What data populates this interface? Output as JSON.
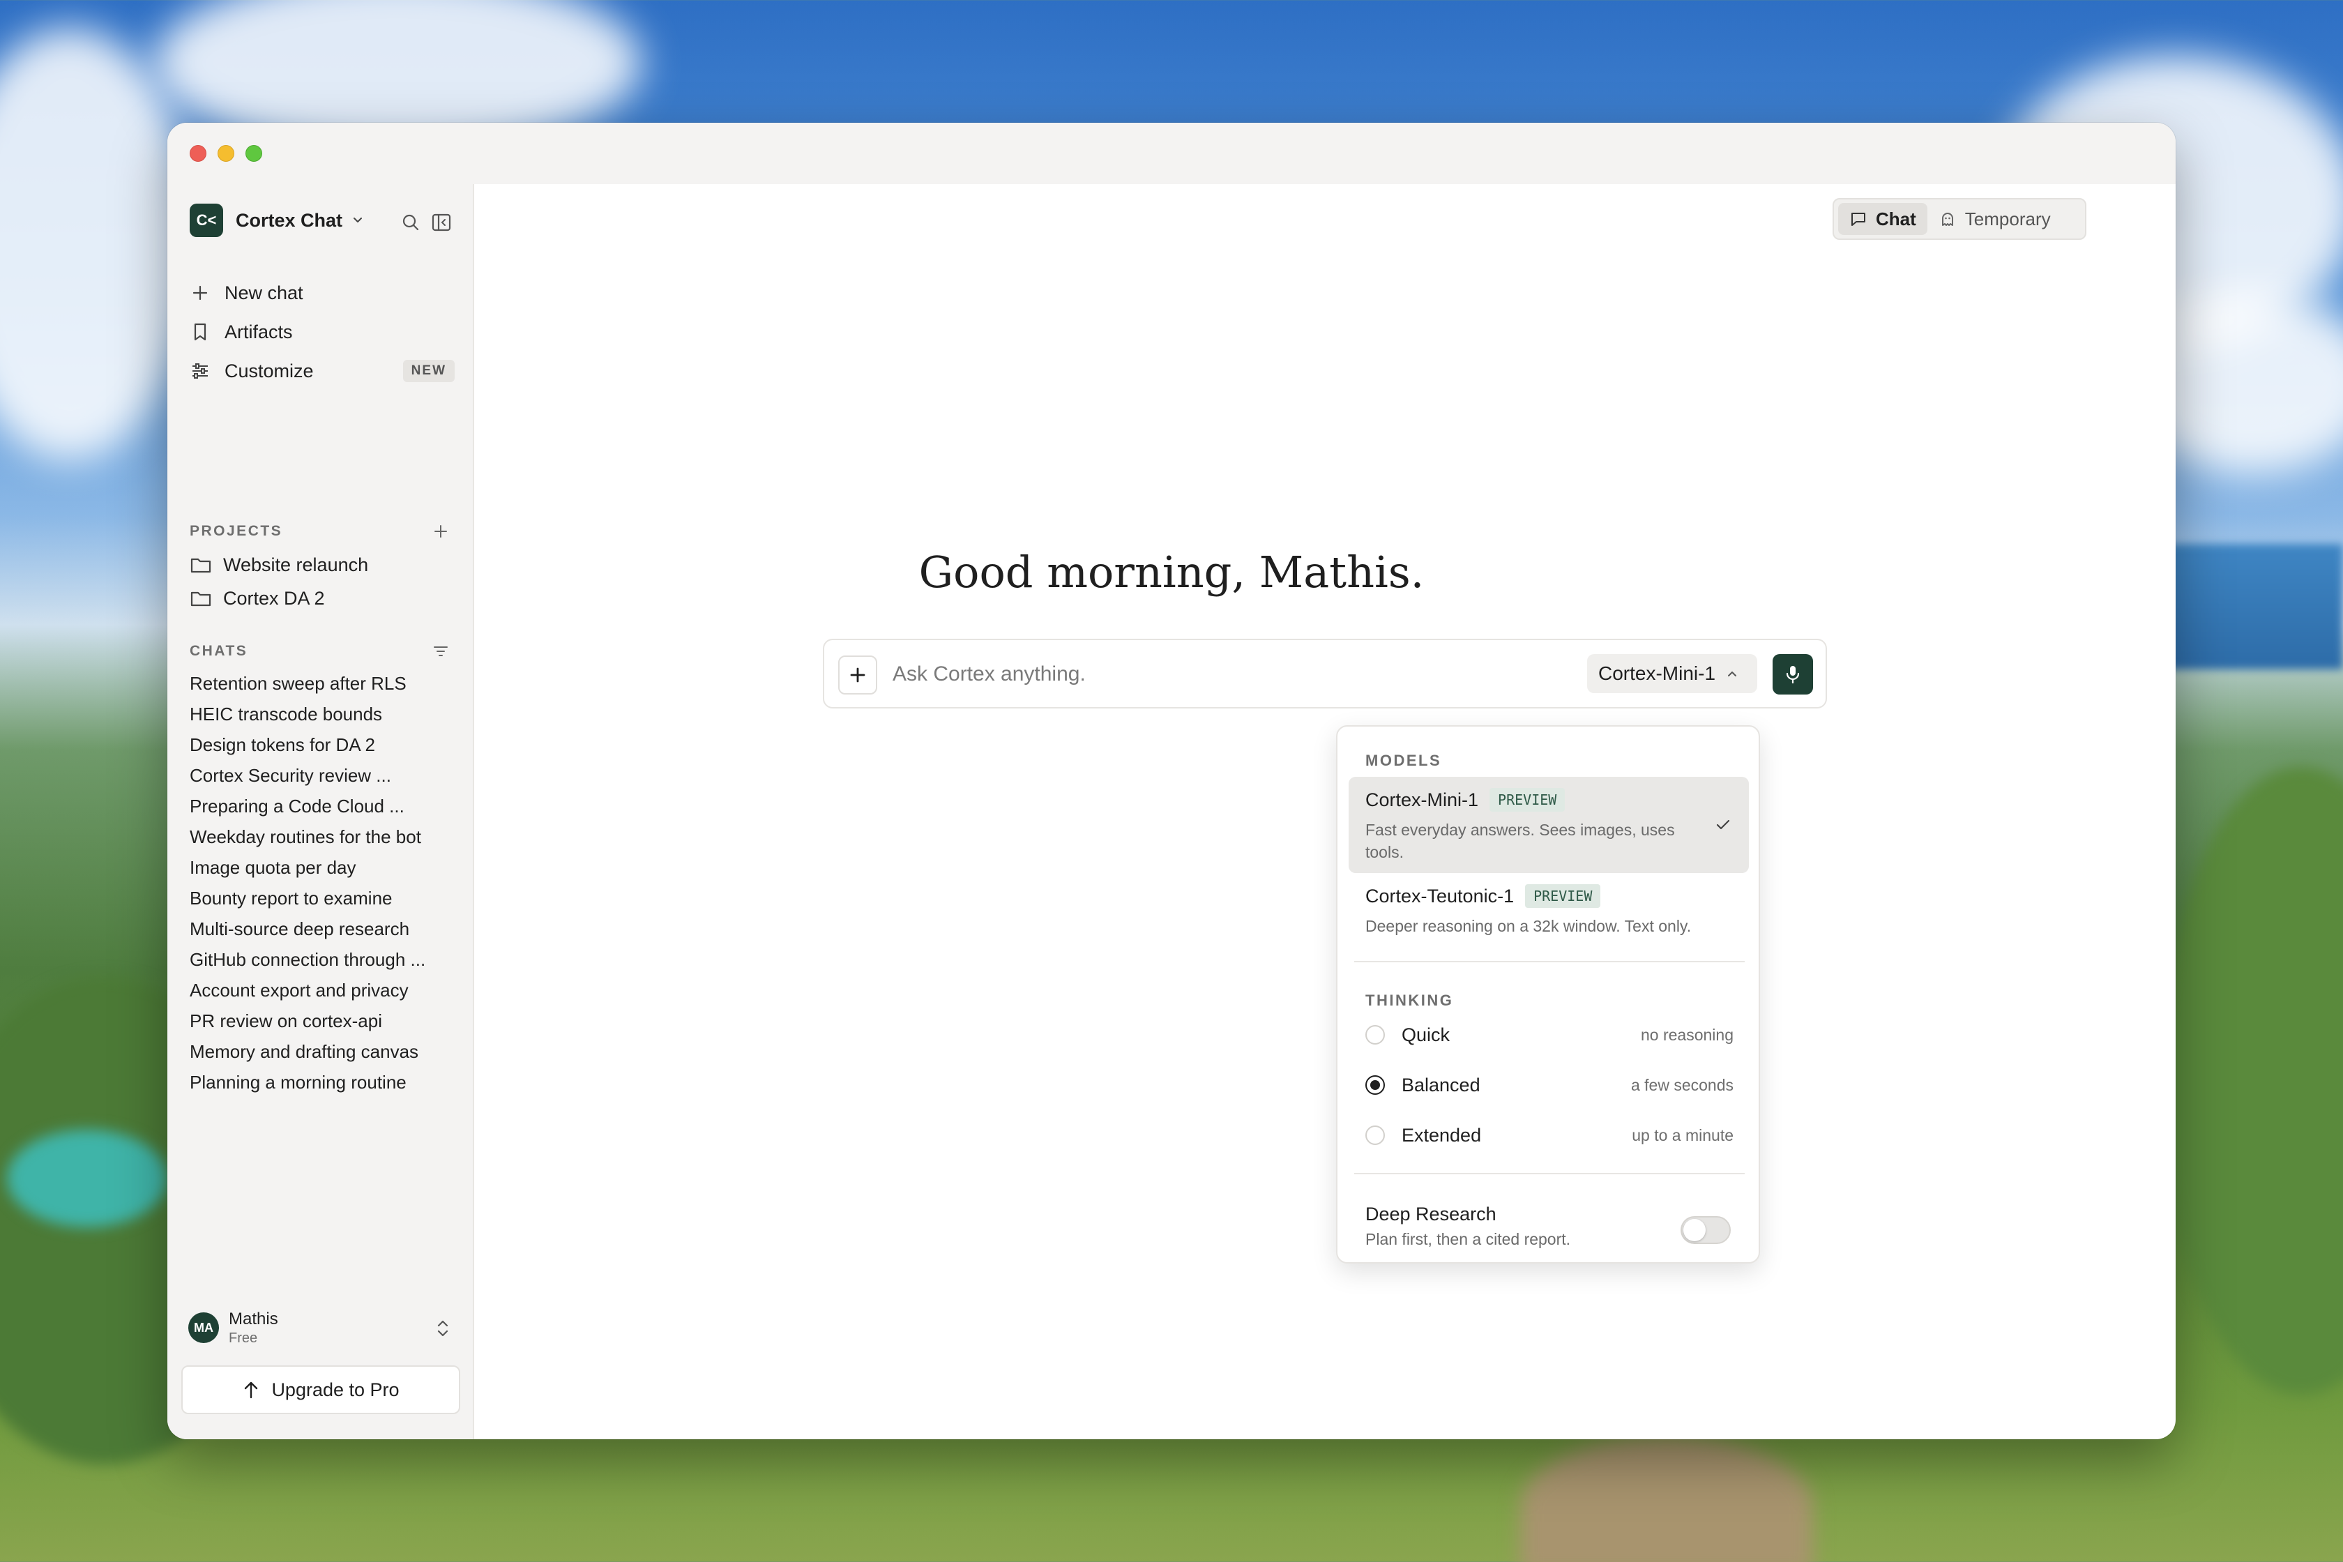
{
  "window": {
    "title": ""
  },
  "sidebar": {
    "brand": {
      "logo_text": "C<",
      "name": "Cortex Chat"
    },
    "nav": [
      {
        "label": "New chat",
        "icon": "plus-icon"
      },
      {
        "label": "Artifacts",
        "icon": "bookmark-icon"
      },
      {
        "label": "Customize",
        "icon": "sliders-icon",
        "badge": "NEW"
      }
    ],
    "projects": {
      "label": "PROJECTS",
      "items": [
        {
          "label": "Website relaunch",
          "icon": "folder-icon"
        },
        {
          "label": "Cortex DA 2",
          "icon": "folder-icon"
        }
      ]
    },
    "chats": {
      "label": "CHATS",
      "items": [
        "Retention sweep after RLS",
        "HEIC transcode bounds",
        "Design tokens for DA 2",
        "Cortex Security review ...",
        "Preparing a Code Cloud ...",
        "Weekday routines for the bot",
        "Image quota per day",
        "Bounty report to examine",
        "Multi-source deep research",
        "GitHub connection through ...",
        "Account export and privacy",
        "PR review on cortex-api",
        "Memory and drafting canvas",
        "Planning a morning routine"
      ]
    },
    "user": {
      "initials": "MA",
      "name": "Mathis",
      "plan": "Free"
    },
    "upgrade_label": "Upgrade to Pro"
  },
  "header": {
    "modes": [
      {
        "label": "Chat",
        "icon": "chat-bubble-icon",
        "active": true
      },
      {
        "label": "Temporary",
        "icon": "ghost-icon",
        "active": false
      }
    ]
  },
  "main": {
    "greeting": "Good morning, Mathis.",
    "composer": {
      "placeholder": "Ask Cortex anything.",
      "value": "",
      "model": "Cortex-Mini-1"
    }
  },
  "model_menu": {
    "models_label": "MODELS",
    "models": [
      {
        "name": "Cortex-Mini-1",
        "badge": "PREVIEW",
        "desc": "Fast everyday answers. Sees images, uses tools.",
        "selected": true
      },
      {
        "name": "Cortex-Teutonic-1",
        "badge": "PREVIEW",
        "desc": "Deeper reasoning on a 32k window. Text only.",
        "selected": false
      }
    ],
    "thinking_label": "THINKING",
    "thinking": [
      {
        "name": "Quick",
        "hint": "no reasoning",
        "selected": false
      },
      {
        "name": "Balanced",
        "hint": "a few seconds",
        "selected": true
      },
      {
        "name": "Extended",
        "hint": "up to a minute",
        "selected": false
      }
    ],
    "deep_research": {
      "title": "Deep Research",
      "desc": "Plan first, then a cited report.",
      "enabled": false
    }
  },
  "colors": {
    "accent": "#1e4034",
    "badge_bg": "#dfe9e3",
    "badge_text": "#2f5a48"
  }
}
